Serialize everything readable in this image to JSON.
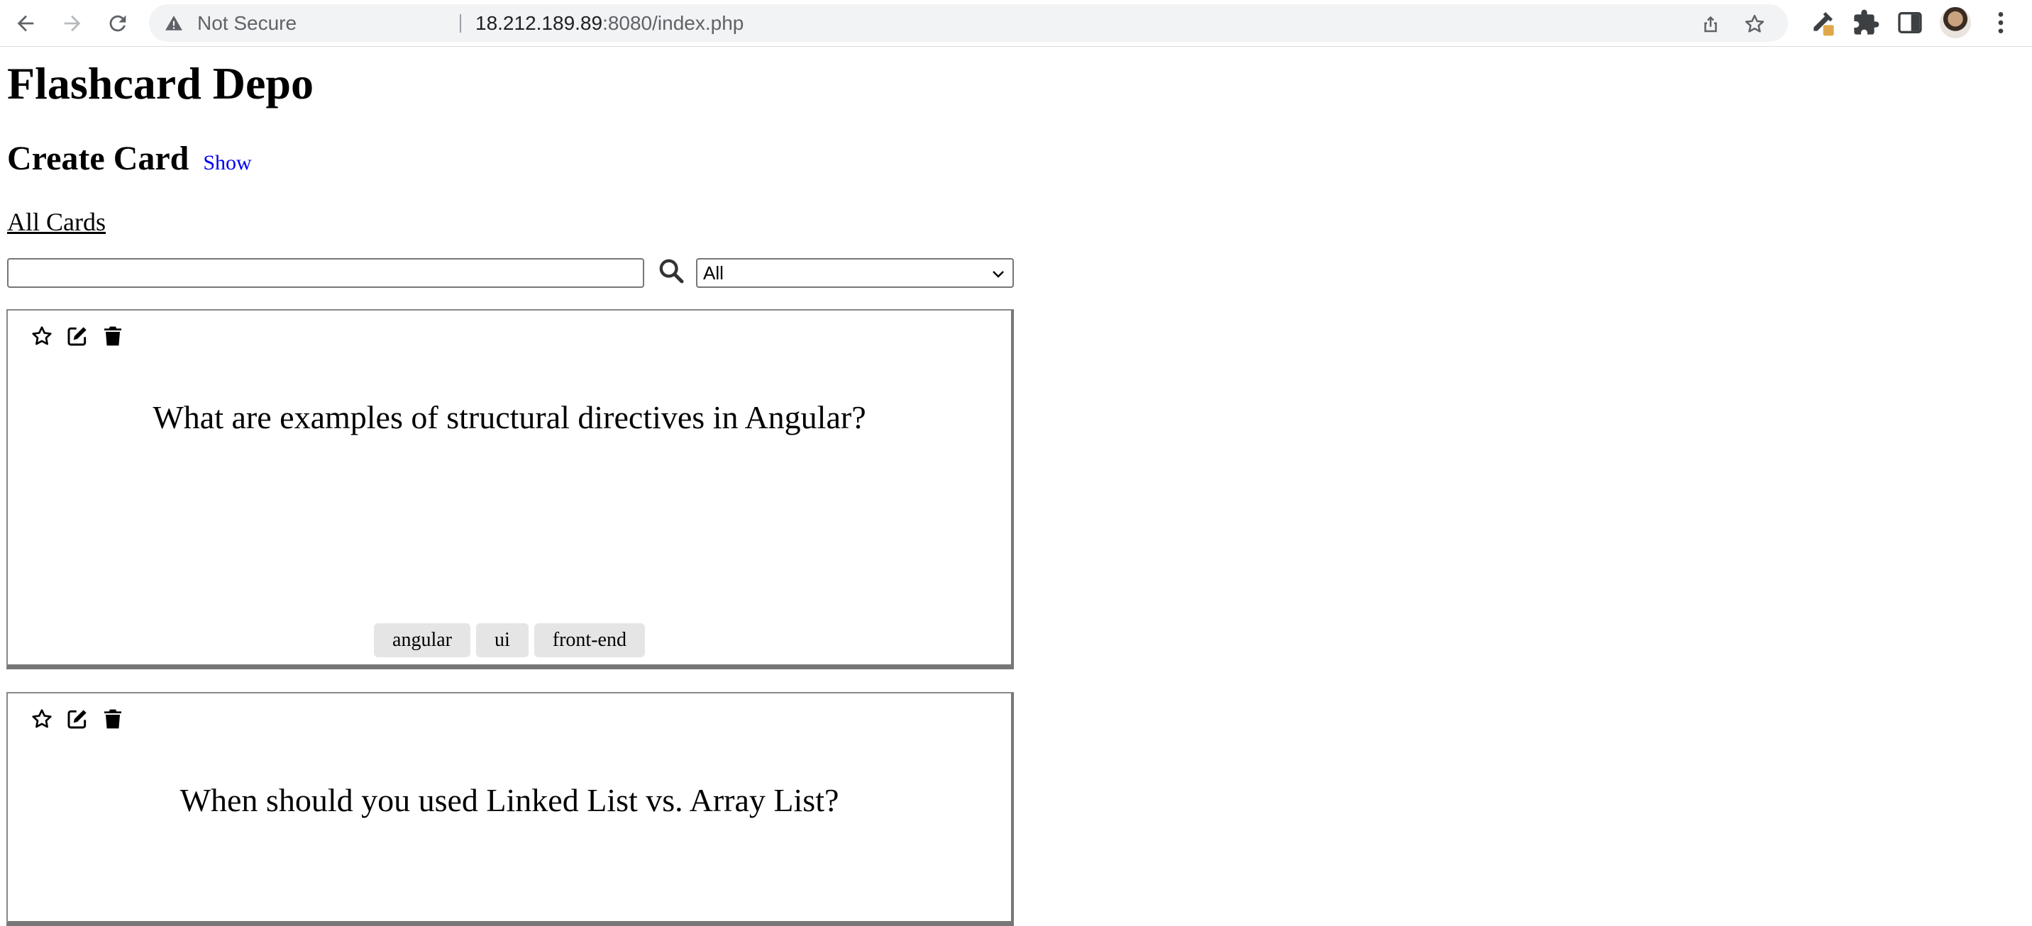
{
  "browser": {
    "security_label": "Not Secure",
    "url_host": "18.212.189.89",
    "url_rest": ":8080/index.php"
  },
  "page": {
    "site_title": "Flashcard Depo",
    "create_title": "Create Card",
    "show_link": "Show",
    "all_cards_label": "All Cards",
    "search_value": "",
    "filter_selected": "All"
  },
  "cards": [
    {
      "question": "What are examples of structural directives in Angular?",
      "tags": [
        "angular",
        "ui",
        "front-end"
      ]
    },
    {
      "question": "When should you used Linked List vs. Array List?",
      "tags": []
    }
  ],
  "icons": {
    "favorite": "star-icon",
    "edit": "edit-icon",
    "delete": "trash-icon"
  }
}
